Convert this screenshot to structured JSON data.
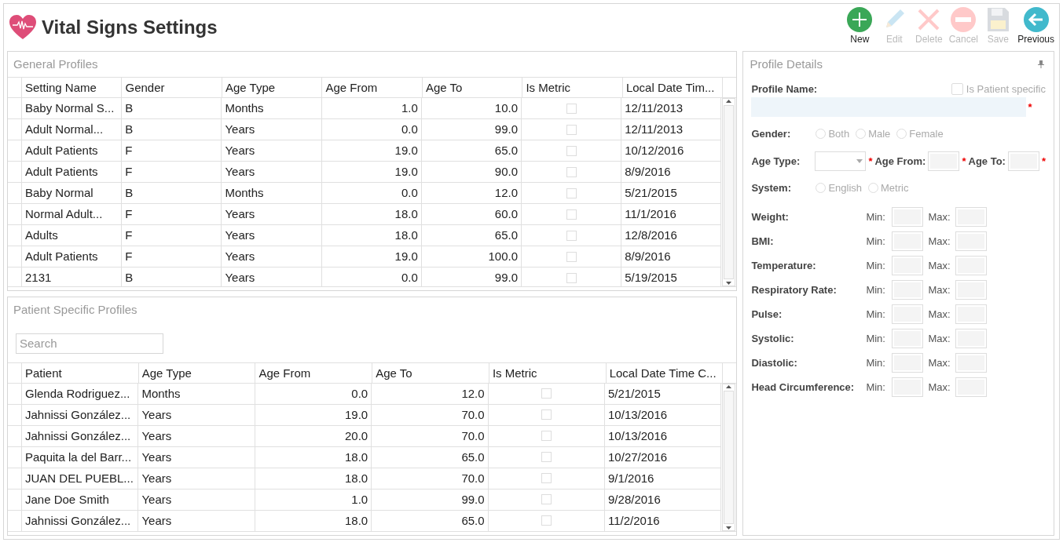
{
  "window": {
    "title": "Vital Signs Settings"
  },
  "toolbar": [
    {
      "kind": "new",
      "label": "New",
      "disabled": false
    },
    {
      "kind": "edit",
      "label": "Edit",
      "disabled": true
    },
    {
      "kind": "delete",
      "label": "Delete",
      "disabled": true
    },
    {
      "kind": "cancel",
      "label": "Cancel",
      "disabled": true
    },
    {
      "kind": "save",
      "label": "Save",
      "disabled": true
    },
    {
      "kind": "previous",
      "label": "Previous",
      "disabled": false
    }
  ],
  "general_profiles": {
    "title": "General Profiles",
    "columns": [
      {
        "label": "Setting Name",
        "kind": "text"
      },
      {
        "label": "Gender",
        "kind": "text"
      },
      {
        "label": "Age Type",
        "kind": "text"
      },
      {
        "label": "Age From",
        "kind": "number"
      },
      {
        "label": "Age To",
        "kind": "number"
      },
      {
        "label": "Is Metric",
        "kind": "check"
      },
      {
        "label": "Local Date Tim...",
        "kind": "text"
      }
    ],
    "rows": [
      {
        "cells": [
          "Baby Normal S...",
          "B",
          "Months",
          "1.0",
          "10.0",
          false,
          "12/11/2013"
        ]
      },
      {
        "cells": [
          "Adult Normal...",
          "B",
          "Years",
          "0.0",
          "99.0",
          false,
          "12/11/2013"
        ]
      },
      {
        "cells": [
          "Adult Patients",
          "F",
          "Years",
          "19.0",
          "65.0",
          false,
          "10/12/2016"
        ]
      },
      {
        "cells": [
          "Adult Patients",
          "F",
          "Years",
          "19.0",
          "90.0",
          false,
          "8/9/2016"
        ]
      },
      {
        "cells": [
          "Baby Normal",
          "B",
          "Months",
          "0.0",
          "12.0",
          false,
          "5/21/2015"
        ]
      },
      {
        "cells": [
          "Normal Adult...",
          "F",
          "Years",
          "18.0",
          "60.0",
          false,
          "11/1/2016"
        ]
      },
      {
        "cells": [
          "Adults",
          "F",
          "Years",
          "18.0",
          "65.0",
          false,
          "12/8/2016"
        ]
      },
      {
        "cells": [
          "Adult Patients",
          "F",
          "Years",
          "19.0",
          "100.0",
          false,
          "8/9/2016"
        ]
      },
      {
        "cells": [
          "2131",
          "B",
          "Years",
          "0.0",
          "99.0",
          false,
          "5/19/2015"
        ]
      }
    ]
  },
  "patient_profiles": {
    "title": "Patient Specific Profiles",
    "search": {
      "placeholder": "Search"
    },
    "columns": [
      {
        "label": "Patient",
        "kind": "text"
      },
      {
        "label": "Age Type",
        "kind": "text"
      },
      {
        "label": "Age From",
        "kind": "number"
      },
      {
        "label": "Age To",
        "kind": "number"
      },
      {
        "label": "Is Metric",
        "kind": "check"
      },
      {
        "label": "Local Date Time C...",
        "kind": "text"
      }
    ],
    "rows": [
      {
        "cells": [
          "Glenda Rodriguez...",
          "Months",
          "0.0",
          "12.0",
          false,
          "5/21/2015"
        ]
      },
      {
        "cells": [
          "Jahnissi González...",
          "Years",
          "19.0",
          "70.0",
          false,
          "10/13/2016"
        ]
      },
      {
        "cells": [
          "Jahnissi González...",
          "Years",
          "20.0",
          "70.0",
          false,
          "10/13/2016"
        ]
      },
      {
        "cells": [
          "Paquita la del Barr...",
          "Years",
          "18.0",
          "65.0",
          false,
          "10/27/2016"
        ]
      },
      {
        "cells": [
          "JUAN DEL PUEBL...",
          "Years",
          "18.0",
          "70.0",
          false,
          "9/1/2016"
        ]
      },
      {
        "cells": [
          "Jane  Doe Smith",
          "Years",
          "1.0",
          "99.0",
          false,
          "9/28/2016"
        ]
      },
      {
        "cells": [
          "Jahnissi González...",
          "Years",
          "18.0",
          "65.0",
          false,
          "11/2/2016"
        ]
      }
    ]
  },
  "profile_details": {
    "title": "Profile Details",
    "profile_name": {
      "label": "Profile Name:",
      "required_mark": "*"
    },
    "is_patient_specific": {
      "label": "Is Patient specific",
      "checked": false,
      "disabled": true
    },
    "gender": {
      "label": "Gender:",
      "disabled": true,
      "options": [
        {
          "label": "Both",
          "selected": false
        },
        {
          "label": "Male",
          "selected": false
        },
        {
          "label": "Female",
          "selected": false
        }
      ]
    },
    "age_type": {
      "label": "Age Type:",
      "required_mark": "*"
    },
    "age_from": {
      "label": "Age From:",
      "required_mark": "*"
    },
    "age_to": {
      "label": "Age To:",
      "required_mark": "*"
    },
    "system": {
      "label": "System:",
      "disabled": true,
      "options": [
        {
          "label": "English",
          "selected": false
        },
        {
          "label": "Metric",
          "selected": false
        }
      ]
    },
    "vitals": [
      {
        "label": "Weight:",
        "min_label": "Min:",
        "max_label": "Max:"
      },
      {
        "label": "BMI:",
        "min_label": "Min:",
        "max_label": "Max:"
      },
      {
        "label": "Temperature:",
        "min_label": "Min:",
        "max_label": "Max:"
      },
      {
        "label": "Respiratory Rate:",
        "min_label": "Min:",
        "max_label": "Max:"
      },
      {
        "label": "Pulse:",
        "min_label": "Min:",
        "max_label": "Max:"
      },
      {
        "label": "Systolic:",
        "min_label": "Min:",
        "max_label": "Max:"
      },
      {
        "label": "Diastolic:",
        "min_label": "Min:",
        "max_label": "Max:"
      },
      {
        "label": "Head Circumference:",
        "min_label": "Min:",
        "max_label": "Max:"
      }
    ]
  }
}
